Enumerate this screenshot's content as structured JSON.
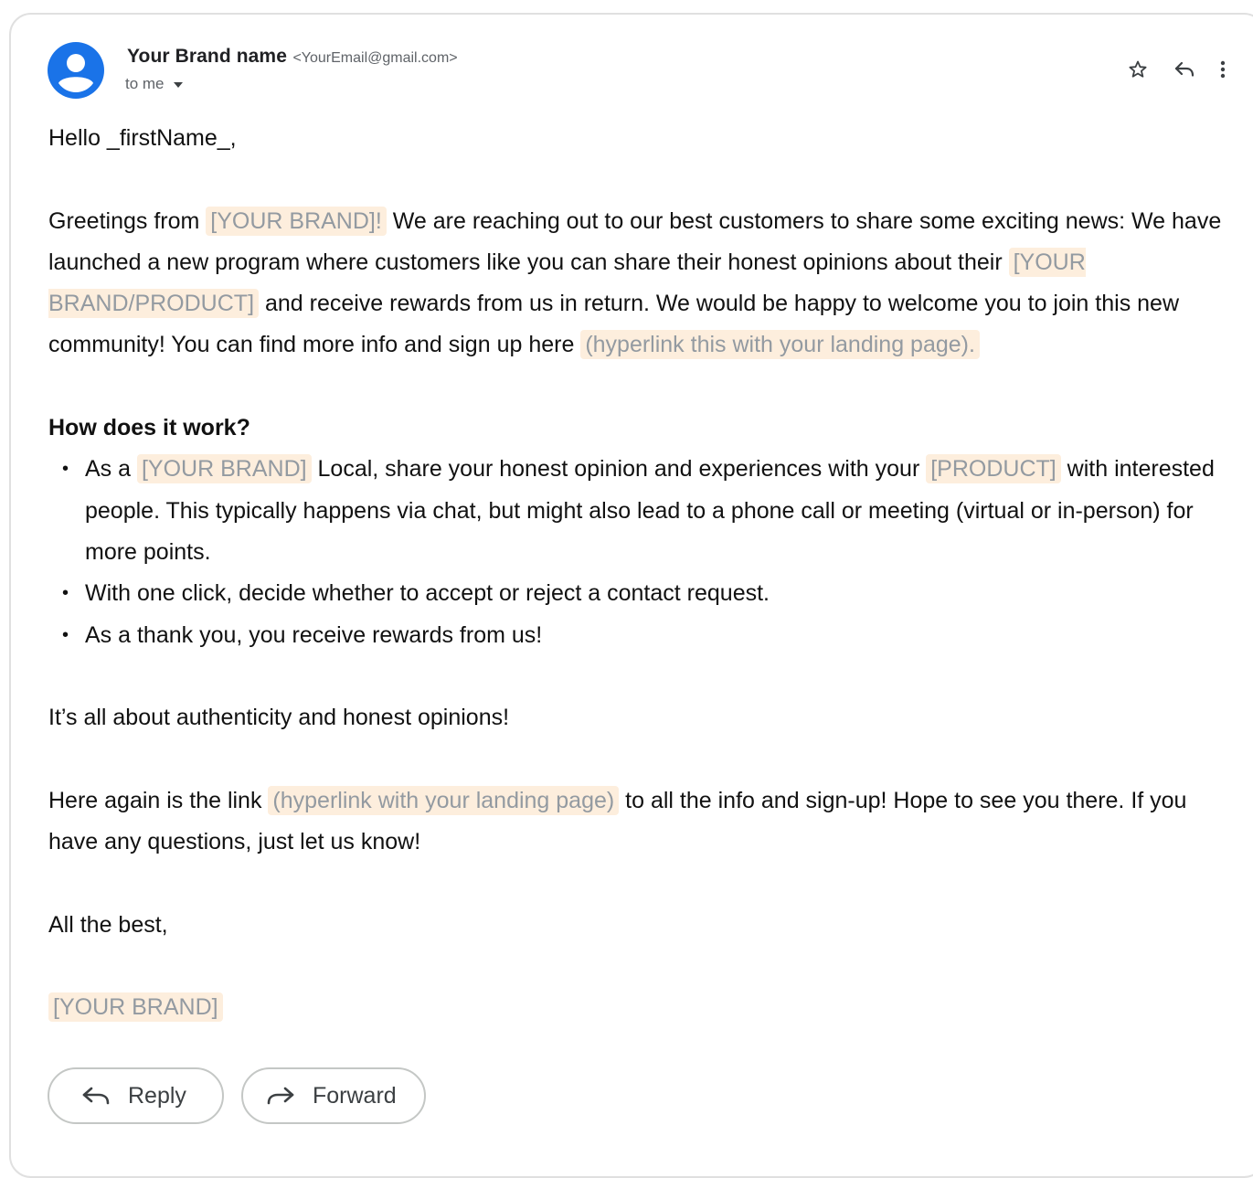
{
  "header": {
    "sender_name": "Your Brand name",
    "sender_email": "<YourEmail@gmail.com>",
    "recipient": "to me",
    "icons": [
      "star-icon",
      "reply-icon",
      "more-vert-icon"
    ]
  },
  "message": {
    "greeting": "Hello _firstName_,",
    "intro": {
      "t1": "Greetings from ",
      "h1": "[YOUR BRAND]!",
      "t2": " We are reaching out to our best customers to share some exciting news: We have launched a new program where customers like you can share their honest opinions about their ",
      "h2": "[YOUR BRAND/PRODUCT]",
      "t3": " and receive rewards from us in return. We would be happy to welcome you to join this new community! You can find more info and sign up here ",
      "h3": "(hyperlink this with your landing page)."
    },
    "how_heading": "How does it work?",
    "bullet1": {
      "t1": "As a ",
      "h1": "[YOUR BRAND]",
      "t2": " Local, share your honest opinion and experiences with your ",
      "h2": "[PRODUCT]",
      "t3": " with interested people. This typically happens via chat, but might also lead to a phone call or meeting (virtual or in-person) for more points."
    },
    "bullet2": "With one click, decide whether to accept or reject a contact request.",
    "bullet3": "As a thank you, you receive rewards from us!",
    "authenticity": "It’s all about authenticity and honest opinions!",
    "closing": {
      "t1": "Here again is the link ",
      "h1": "(hyperlink with your landing page)",
      "t2": " to all the info and sign-up! Hope to see you there. If you have any questions, just let us know!"
    },
    "signoff": "All the best,",
    "signature": "[YOUR BRAND]"
  },
  "actions": {
    "reply_label": "Reply",
    "forward_label": "Forward"
  },
  "colors": {
    "avatar": "#1a73e8",
    "placeholder_bg": "#fdeedd",
    "placeholder_text": "#939aa1"
  }
}
